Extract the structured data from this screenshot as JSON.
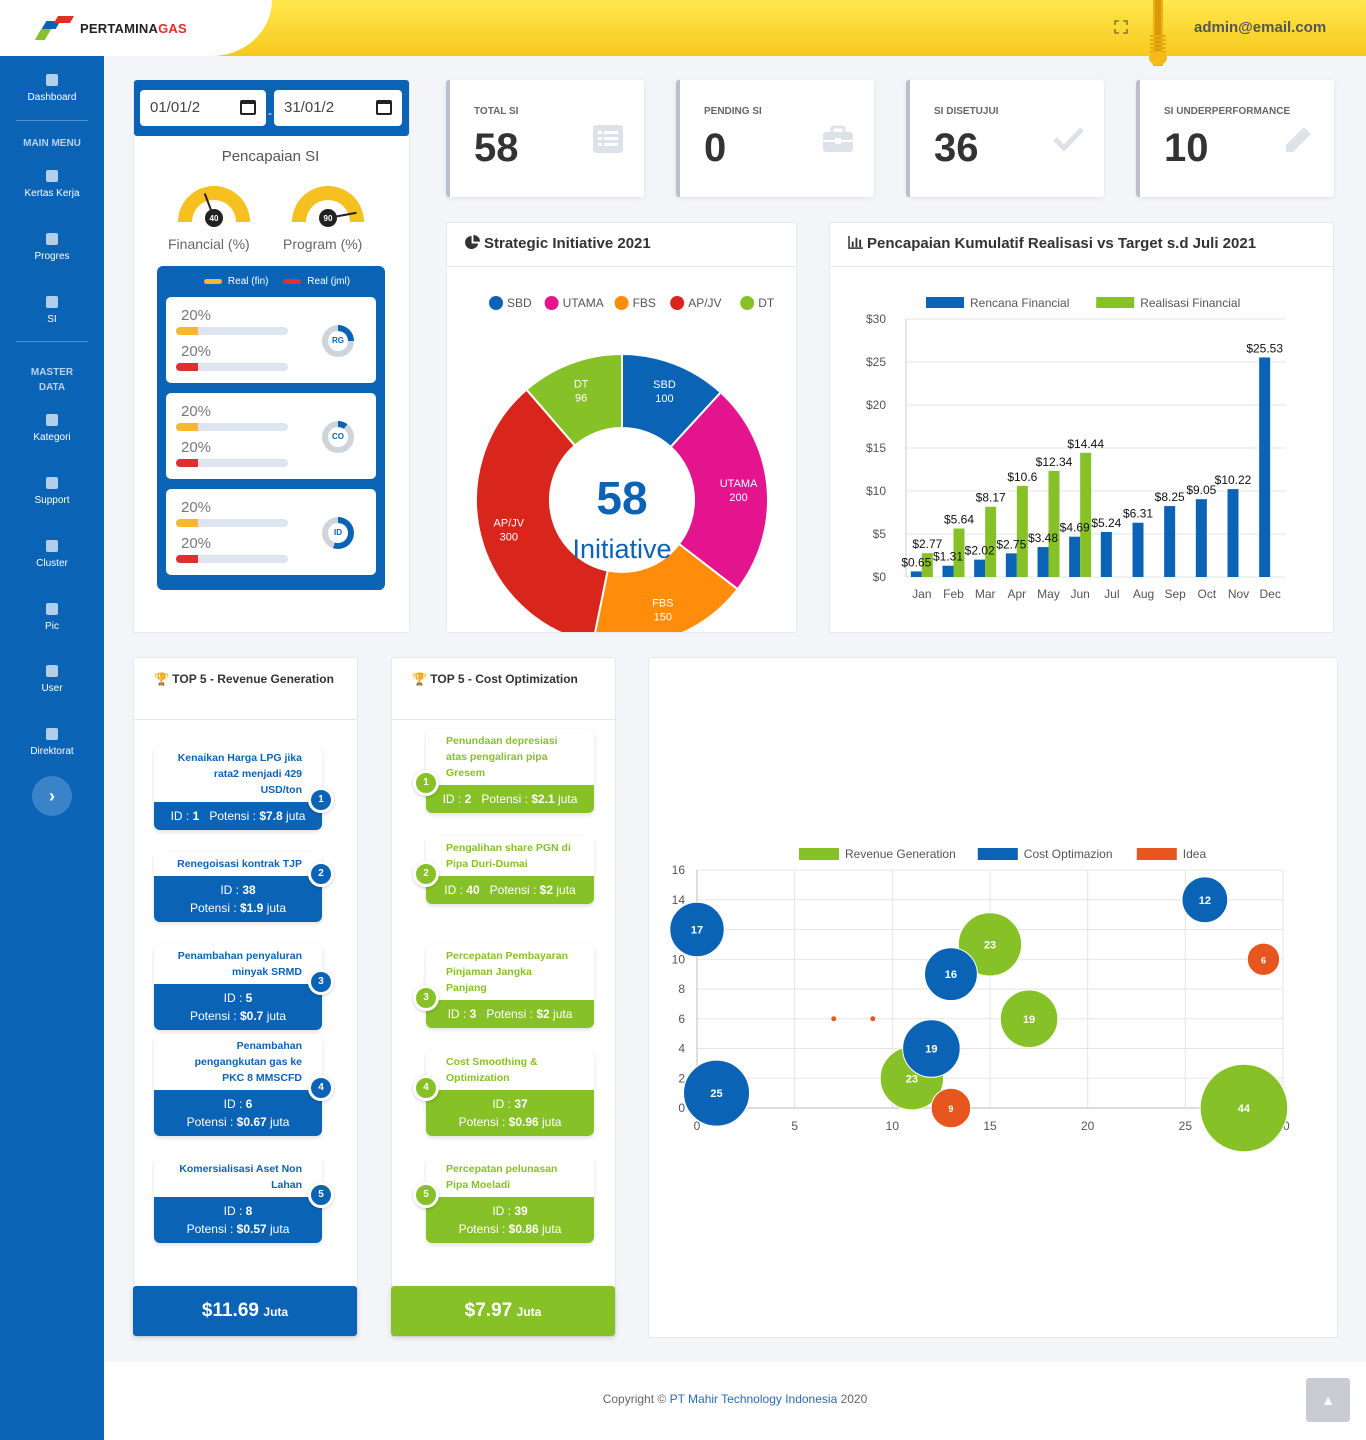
{
  "brand": {
    "name_a": "PERTAMINA",
    "name_b": "GAS"
  },
  "header": {
    "user": "admin@email.com",
    "fullscreen_icon": "expand-icon"
  },
  "sidebar": {
    "items": [
      {
        "label": "Dashboard",
        "icon": "paw-icon"
      },
      {
        "label": "Kertas Kerja",
        "icon": "file-icon"
      },
      {
        "label": "Progres",
        "icon": "hourglass-icon"
      },
      {
        "label": "SI",
        "icon": "square-icon"
      },
      {
        "label": "Kategori",
        "icon": "archive-icon"
      },
      {
        "label": "Support",
        "icon": "hand-icon"
      },
      {
        "label": "Cluster",
        "icon": "leaf-icon"
      },
      {
        "label": "Pic",
        "icon": "chip-icon"
      },
      {
        "label": "User",
        "icon": "users-icon"
      },
      {
        "label": "Direktorat",
        "icon": "flask-icon"
      }
    ],
    "section_main": "MAIN MENU",
    "section_master": "MASTER DATA",
    "toggle": "›"
  },
  "filter": {
    "date_from": "01/01/2",
    "date_to": "31/01/2",
    "separator": "-"
  },
  "pencapaian": {
    "title": "Pencapaian SI",
    "gauges": [
      {
        "label": "Financial (%)",
        "value": 40
      },
      {
        "label": "Program (%)",
        "value": 90
      }
    ],
    "legend": [
      {
        "label": "Real (fin)",
        "color": "#f7b733"
      },
      {
        "label": "Real (jml)",
        "color": "#e0302a"
      }
    ],
    "items": [
      {
        "fin": "20%",
        "jml": "20%",
        "fin_fill": 0.2,
        "jml_fill": 0.2,
        "code": "RG",
        "ring": 0.25
      },
      {
        "fin": "20%",
        "jml": "20%",
        "fin_fill": 0.2,
        "jml_fill": 0.2,
        "code": "CO",
        "ring": 0.1
      },
      {
        "fin": "20%",
        "jml": "20%",
        "fin_fill": 0.2,
        "jml_fill": 0.2,
        "code": "ID",
        "ring": 0.55
      }
    ]
  },
  "stats": [
    {
      "label": "TOTAL SI",
      "value": "58",
      "icon": "list-icon"
    },
    {
      "label": "PENDING SI",
      "value": "0",
      "icon": "briefcase-icon"
    },
    {
      "label": "SI DISETUJUI",
      "value": "36",
      "icon": "check-icon"
    },
    {
      "label": "SI UNDERPERFORMANCE",
      "value": "10",
      "icon": "pencil-icon"
    }
  ],
  "strategic": {
    "title": "Strategic Initiative 2021",
    "center_value": "58",
    "center_label": "Initiative"
  },
  "kumulatif": {
    "title": "Pencapaian Kumulatif Realisasi vs Target s.d Juli 2021"
  },
  "top5_revenue": {
    "title": "TOP 5 - Revenue Generation",
    "items": [
      {
        "rank": "1",
        "title": "Kenaikan Harga LPG jika rata2 menjadi 429 USD/ton",
        "id_label": "ID : ",
        "id": "1",
        "pot_label": "Potensi : ",
        "potensi": "$7.8",
        "unit": "juta"
      },
      {
        "rank": "2",
        "title": "Renegoisasi kontrak TJP",
        "id_label": "ID : ",
        "id": "38",
        "pot_label": "Potensi : ",
        "potensi": "$1.9",
        "unit": "juta"
      },
      {
        "rank": "3",
        "title": "Penambahan penyaluran minyak SRMD",
        "id_label": "ID : ",
        "id": "5",
        "pot_label": "Potensi : ",
        "potensi": "$0.7",
        "unit": "juta"
      },
      {
        "rank": "4",
        "title": "Penambahan pengangkutan gas ke PKC 8 MMSCFD",
        "id_label": "ID : ",
        "id": "6",
        "pot_label": "Potensi : ",
        "potensi": "$0.67",
        "unit": "juta"
      },
      {
        "rank": "5",
        "title": "Komersialisasi Aset Non Lahan",
        "id_label": "ID : ",
        "id": "8",
        "pot_label": "Potensi : ",
        "potensi": "$0.57",
        "unit": "juta"
      }
    ],
    "total": "$11.69",
    "total_unit": "Juta"
  },
  "top5_cost": {
    "title": "TOP 5 - Cost Optimization",
    "items": [
      {
        "rank": "1",
        "title": "Penundaan depresiasi atas pengaliran pipa Gresem",
        "id_label": "ID : ",
        "id": "2",
        "pot_label": "Potensi : ",
        "potensi": "$2.1",
        "unit": "juta"
      },
      {
        "rank": "2",
        "title": "Pengalihan share PGN di Pipa Duri-Dumai",
        "id_label": "ID : ",
        "id": "40",
        "pot_label": "Potensi : ",
        "potensi": "$2",
        "unit": "juta"
      },
      {
        "rank": "3",
        "title": "Percepatan Pembayaran Pinjaman Jangka Panjang",
        "id_label": "ID : ",
        "id": "3",
        "pot_label": "Potensi : ",
        "potensi": "$2",
        "unit": "juta"
      },
      {
        "rank": "4",
        "title": "Cost Smoothing & Optimization",
        "id_label": "ID : ",
        "id": "37",
        "pot_label": "Potensi : ",
        "potensi": "$0.96",
        "unit": "juta"
      },
      {
        "rank": "5",
        "title": "Percepatan pelunasan Pipa Moeladi",
        "id_label": "ID : ",
        "id": "39",
        "pot_label": "Potensi : ",
        "potensi": "$0.86",
        "unit": "juta"
      }
    ],
    "total": "$7.97",
    "total_unit": "Juta"
  },
  "footer": {
    "text": "Copyright © ",
    "company": "PT Mahir Technology Indonesia",
    "year": " 2020",
    "totop": "▲"
  },
  "chart_data": [
    {
      "type": "pie",
      "variant": "doughnut",
      "legend_position": "top",
      "labels": [
        "SBD",
        "UTAMA",
        "FBS",
        "AP/JV",
        "DT"
      ],
      "values": [
        100,
        200,
        150,
        300,
        96
      ],
      "colors": [
        "#0b63b6",
        "#e3148e",
        "#ff8c0a",
        "#d9261c",
        "#86c127"
      ]
    },
    {
      "type": "bar",
      "categories": [
        "Jan",
        "Feb",
        "Mar",
        "Apr",
        "May",
        "Jun",
        "Jul",
        "Aug",
        "Sep",
        "Oct",
        "Nov",
        "Dec"
      ],
      "series": [
        {
          "name": "Rencana Financial",
          "color": "#0b63b6",
          "values": [
            0.65,
            1.31,
            2.02,
            2.75,
            3.48,
            4.69,
            5.24,
            6.31,
            8.25,
            9.05,
            10.22,
            25.53
          ]
        },
        {
          "name": "Realisasi Financial",
          "color": "#86c127",
          "values": [
            2.77,
            5.64,
            8.17,
            10.6,
            12.34,
            14.44,
            null,
            null,
            null,
            null,
            null,
            null
          ]
        }
      ],
      "ylim": [
        0,
        30
      ],
      "yticks": [
        "$0",
        "$5",
        "$10",
        "$15",
        "$20",
        "$25",
        "$30"
      ],
      "legend_position": "top"
    },
    {
      "type": "scatter",
      "variant": "bubble",
      "legend_position": "top",
      "xlim": [
        0,
        30
      ],
      "ylim": [
        0,
        16
      ],
      "xticks": [
        "0",
        "5",
        "10",
        "15",
        "20",
        "25",
        "30"
      ],
      "yticks": [
        "0",
        "2",
        "4",
        "6",
        "8",
        "10",
        "12",
        "14",
        "16"
      ],
      "series": [
        {
          "name": "Revenue Generation",
          "color": "#86c127",
          "points": [
            {
              "x": 15,
              "y": 11,
              "label": "23"
            },
            {
              "x": 17,
              "y": 6,
              "label": "19"
            },
            {
              "x": 11,
              "y": 2,
              "label": "23"
            },
            {
              "x": 28,
              "y": 0,
              "label": "44"
            }
          ]
        },
        {
          "name": "Cost Optimazion",
          "color": "#0b63b6",
          "points": [
            {
              "x": 26,
              "y": 14,
              "label": "12"
            },
            {
              "x": 0,
              "y": 12,
              "label": "17"
            },
            {
              "x": 13,
              "y": 9,
              "label": "16"
            },
            {
              "x": 12,
              "y": 4,
              "label": "19"
            },
            {
              "x": 1,
              "y": 1,
              "label": "25"
            }
          ]
        },
        {
          "name": "Idea",
          "color": "#e8561f",
          "points": [
            {
              "x": 29,
              "y": 10,
              "label": "6"
            },
            {
              "x": 13,
              "y": 0,
              "label": "9"
            },
            {
              "x": 9,
              "y": 6,
              "label": ""
            },
            {
              "x": 7,
              "y": 6,
              "label": ""
            }
          ]
        }
      ]
    }
  ]
}
